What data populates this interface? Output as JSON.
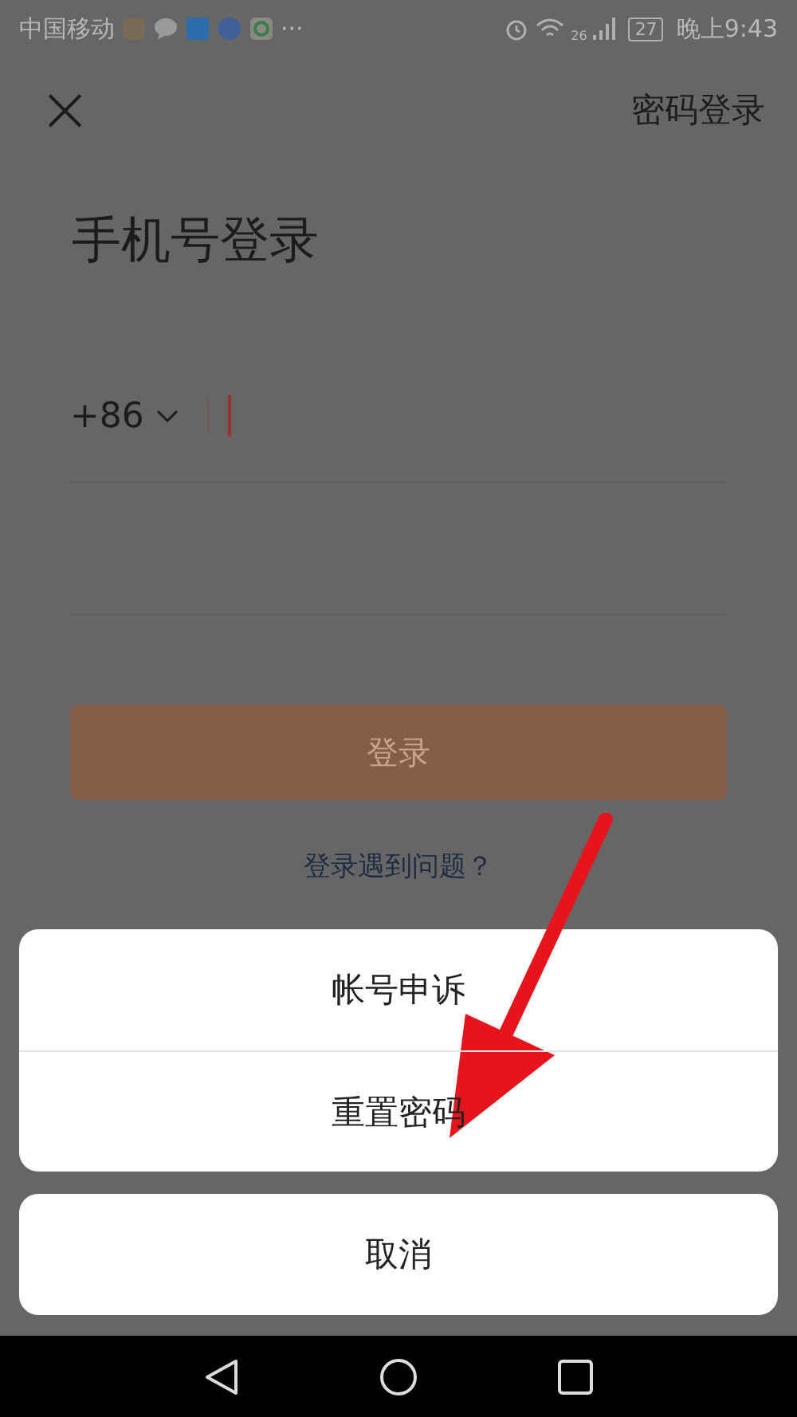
{
  "status_bar": {
    "carrier": "中国移动",
    "more": "···",
    "network": "26",
    "battery": "27",
    "time": "晚上9:43"
  },
  "header": {
    "close": "×",
    "switch_link": "密码登录"
  },
  "title": "手机号登录",
  "phone_field": {
    "country_code": "+86"
  },
  "login_button": {
    "label": "登录",
    "disabled": true
  },
  "help_link": "登录遇到问题？",
  "action_sheet": {
    "options": [
      {
        "label": "帐号申诉"
      },
      {
        "label": "重置密码"
      }
    ],
    "cancel": "取消"
  },
  "annotation": {
    "kind": "arrow",
    "color": "#e8141b"
  }
}
